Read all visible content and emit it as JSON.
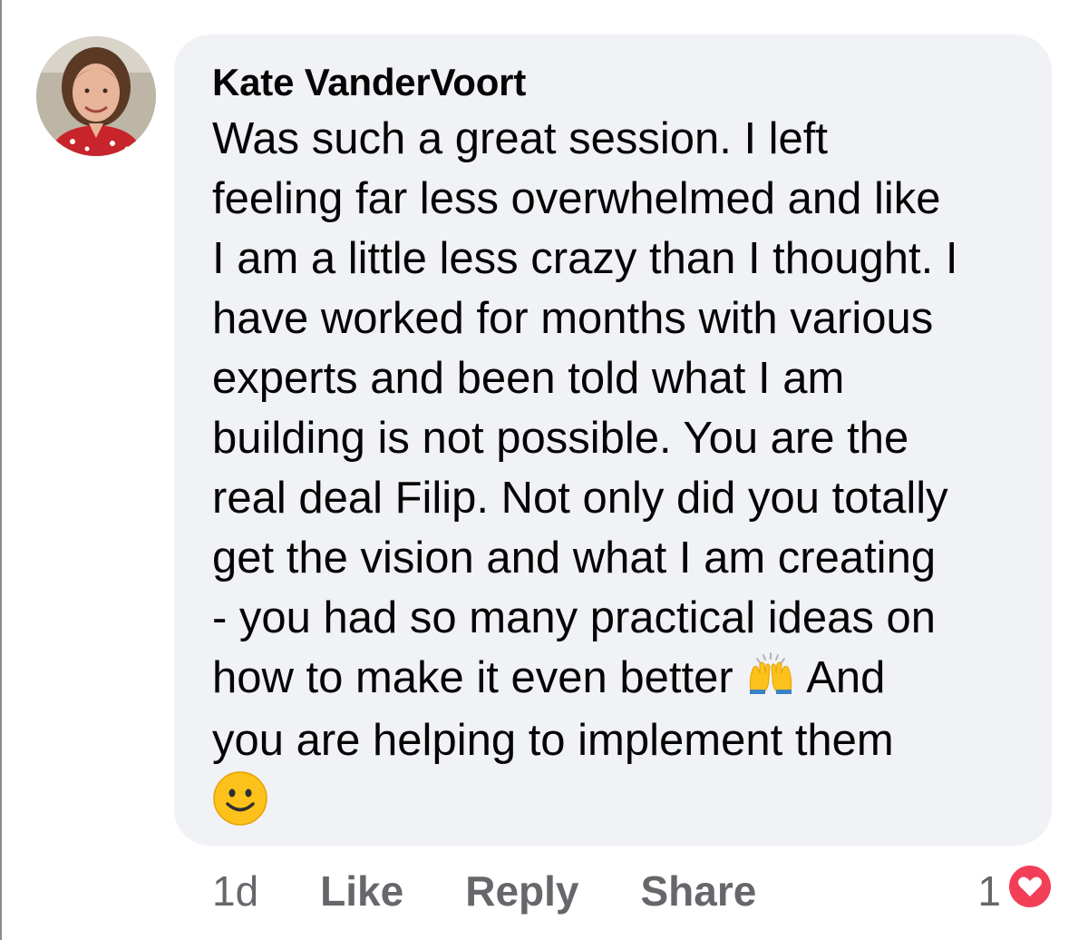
{
  "comment": {
    "author": "Kate VanderVoort",
    "lines": [
      "Was such a great session. I left",
      "feeling far less overwhelmed and like",
      "I am a little less crazy than I thought. I",
      "have worked for months with various",
      "experts and been told what I am",
      "building is not possible. You are the",
      "real deal Filip. Not only did you totally",
      "get the vision and what I am creating",
      "- you had so many practical ideas on",
      "how to make it even better",
      "And",
      "you are helping to implement them"
    ],
    "emojis": [
      "raising-hands-emoji",
      "smiling-face-emoji"
    ]
  },
  "actions": {
    "timestamp": "1d",
    "like": "Like",
    "reply": "Reply",
    "share": "Share"
  },
  "reactions": {
    "count": "1",
    "icon": "heart-icon",
    "color": "#f33e58"
  },
  "colors": {
    "bubble": "#f0f2f5",
    "secondary_text": "#65676b",
    "primary_text": "#050505"
  }
}
